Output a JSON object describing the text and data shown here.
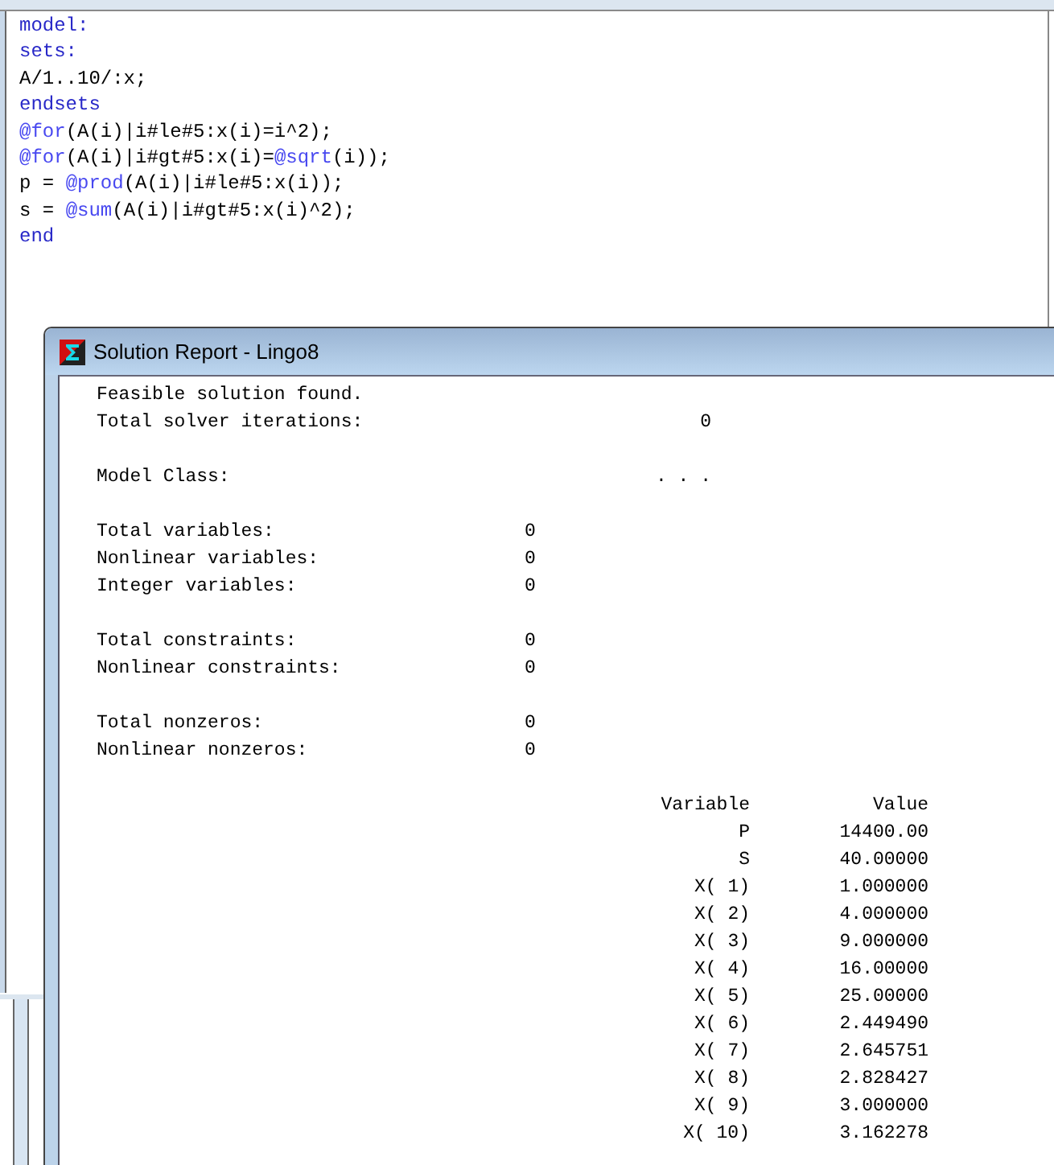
{
  "editor": {
    "lines": [
      [
        {
          "text": "model:",
          "kind": "keyword"
        }
      ],
      [
        {
          "text": "sets:",
          "kind": "keyword"
        }
      ],
      [
        {
          "text": "A/1..10/:x;",
          "kind": "plain"
        }
      ],
      [
        {
          "text": "endsets",
          "kind": "keyword"
        }
      ],
      [
        {
          "text": "@for",
          "kind": "function"
        },
        {
          "text": "(A(i)|i#le#5:x(i)=i^2);",
          "kind": "plain"
        }
      ],
      [
        {
          "text": "@for",
          "kind": "function"
        },
        {
          "text": "(A(i)|i#gt#5:x(i)=",
          "kind": "plain"
        },
        {
          "text": "@sqrt",
          "kind": "function"
        },
        {
          "text": "(i));",
          "kind": "plain"
        }
      ],
      [
        {
          "text": "p = ",
          "kind": "plain"
        },
        {
          "text": "@prod",
          "kind": "function"
        },
        {
          "text": "(A(i)|i#le#5:x(i));",
          "kind": "plain"
        }
      ],
      [
        {
          "text": "s = ",
          "kind": "plain"
        },
        {
          "text": "@sum",
          "kind": "function"
        },
        {
          "text": "(A(i)|i#gt#5:x(i)^2);",
          "kind": "plain"
        }
      ],
      [
        {
          "text": "end",
          "kind": "keyword"
        }
      ]
    ]
  },
  "report": {
    "title": "Solution Report - Lingo8",
    "groups": [
      [
        {
          "kind": "message",
          "label": "Feasible solution found."
        },
        {
          "kind": "solver",
          "label": "Total solver iterations:",
          "value": "0"
        }
      ],
      [
        {
          "kind": "solver",
          "label": "Model Class:",
          "value": ". . ."
        }
      ],
      [
        {
          "kind": "count",
          "label": "Total variables:",
          "value": "0"
        },
        {
          "kind": "count",
          "label": "Nonlinear variables:",
          "value": "0"
        },
        {
          "kind": "count",
          "label": "Integer variables:",
          "value": "0"
        }
      ],
      [
        {
          "kind": "count",
          "label": "Total constraints:",
          "value": "0"
        },
        {
          "kind": "count",
          "label": "Nonlinear constraints:",
          "value": "0"
        }
      ],
      [
        {
          "kind": "count",
          "label": "Total nonzeros:",
          "value": "0"
        },
        {
          "kind": "count",
          "label": "Nonlinear nonzeros:",
          "value": "0"
        }
      ]
    ],
    "table": {
      "columns": [
        "Variable",
        "Value"
      ],
      "rows": [
        [
          "P",
          "14400.00"
        ],
        [
          "S",
          "40.00000"
        ],
        [
          "X( 1)",
          "1.000000"
        ],
        [
          "X( 2)",
          "4.000000"
        ],
        [
          "X( 3)",
          "9.000000"
        ],
        [
          "X( 4)",
          "16.00000"
        ],
        [
          "X( 5)",
          "25.00000"
        ],
        [
          "X( 6)",
          "2.449490"
        ],
        [
          "X( 7)",
          "2.645751"
        ],
        [
          "X( 8)",
          "2.828427"
        ],
        [
          "X( 9)",
          "3.000000"
        ],
        [
          "X( 10)",
          "3.162278"
        ]
      ]
    }
  }
}
